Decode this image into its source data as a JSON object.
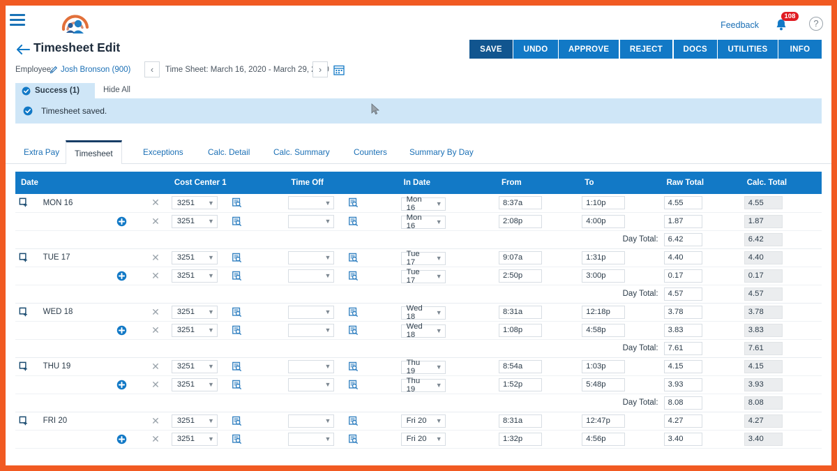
{
  "window": {
    "accent_orange": "#f15a22",
    "brand_blue": "#1279c6"
  },
  "topbar": {
    "menu_icon": "hamburger-icon",
    "logo_icon": "company-logo",
    "feedback_label": "Feedback",
    "bell_icon": "notification-bell-icon",
    "notification_count": "108",
    "help_label": "?"
  },
  "header": {
    "back_icon": "back-arrow-icon",
    "title": "Timesheet Edit",
    "actions": [
      {
        "label": "SAVE",
        "active": true
      },
      {
        "label": "UNDO",
        "active": false
      },
      {
        "label": "APPROVE",
        "active": false
      },
      {
        "label": "REJECT",
        "active": false
      },
      {
        "label": "DOCS",
        "active": false
      },
      {
        "label": "UTILITIES",
        "active": false
      },
      {
        "label": "INFO",
        "active": false
      }
    ]
  },
  "employee_bar": {
    "label": "Employee:",
    "edit_icon": "pencil-icon",
    "name": "Josh Bronson (900)",
    "prev_label": "‹",
    "next_label": "›",
    "timesheet_range": "Time Sheet: March 16, 2020 - March 29, 2020",
    "calendar_icon": "calendar-icon"
  },
  "status": {
    "tab_label": "Success (1)",
    "hide_all_label": "Hide All",
    "message": "Timesheet saved.",
    "check_icon": "check-circle-icon"
  },
  "tabs": [
    {
      "label": "Extra Pay",
      "active": false
    },
    {
      "label": "Timesheet",
      "active": true
    },
    {
      "label": "Exceptions",
      "active": false
    },
    {
      "label": "Calc. Detail",
      "active": false
    },
    {
      "label": "Calc. Summary",
      "active": false
    },
    {
      "label": "Counters",
      "active": false
    },
    {
      "label": "Summary By Day",
      "active": false
    }
  ],
  "table": {
    "columns": [
      "Date",
      "Cost Center 1",
      "Time Off",
      "In Date",
      "From",
      "To",
      "Raw Total",
      "Calc. Total"
    ],
    "day_total_label": "Day Total:",
    "copy_icon": "copy-row-icon",
    "add_icon": "add-row-icon",
    "delete_icon": "delete-row-icon",
    "lookup_icon": "lookup-search-icon",
    "days": [
      {
        "date": "MON 16",
        "day_total_raw": "6.42",
        "day_total_calc": "6.42",
        "entries": [
          {
            "cost_center": "3251",
            "time_off": "",
            "in_date": "Mon 16",
            "from": "8:37a",
            "to": "1:10p",
            "raw_total": "4.55",
            "calc_total": "4.55"
          },
          {
            "cost_center": "3251",
            "time_off": "",
            "in_date": "Mon 16",
            "from": "2:08p",
            "to": "4:00p",
            "raw_total": "1.87",
            "calc_total": "1.87"
          }
        ]
      },
      {
        "date": "TUE 17",
        "day_total_raw": "4.57",
        "day_total_calc": "4.57",
        "entries": [
          {
            "cost_center": "3251",
            "time_off": "",
            "in_date": "Tue 17",
            "from": "9:07a",
            "to": "1:31p",
            "raw_total": "4.40",
            "calc_total": "4.40"
          },
          {
            "cost_center": "3251",
            "time_off": "",
            "in_date": "Tue 17",
            "from": "2:50p",
            "to": "3:00p",
            "raw_total": "0.17",
            "calc_total": "0.17"
          }
        ]
      },
      {
        "date": "WED 18",
        "day_total_raw": "7.61",
        "day_total_calc": "7.61",
        "entries": [
          {
            "cost_center": "3251",
            "time_off": "",
            "in_date": "Wed 18",
            "from": "8:31a",
            "to": "12:18p",
            "raw_total": "3.78",
            "calc_total": "3.78"
          },
          {
            "cost_center": "3251",
            "time_off": "",
            "in_date": "Wed 18",
            "from": "1:08p",
            "to": "4:58p",
            "raw_total": "3.83",
            "calc_total": "3.83"
          }
        ]
      },
      {
        "date": "THU 19",
        "day_total_raw": "8.08",
        "day_total_calc": "8.08",
        "entries": [
          {
            "cost_center": "3251",
            "time_off": "",
            "in_date": "Thu 19",
            "from": "8:54a",
            "to": "1:03p",
            "raw_total": "4.15",
            "calc_total": "4.15"
          },
          {
            "cost_center": "3251",
            "time_off": "",
            "in_date": "Thu 19",
            "from": "1:52p",
            "to": "5:48p",
            "raw_total": "3.93",
            "calc_total": "3.93"
          }
        ]
      },
      {
        "date": "FRI 20",
        "day_total_raw": "",
        "day_total_calc": "",
        "entries": [
          {
            "cost_center": "3251",
            "time_off": "",
            "in_date": "Fri 20",
            "from": "8:31a",
            "to": "12:47p",
            "raw_total": "4.27",
            "calc_total": "4.27"
          },
          {
            "cost_center": "3251",
            "time_off": "",
            "in_date": "Fri 20",
            "from": "1:32p",
            "to": "4:56p",
            "raw_total": "3.40",
            "calc_total": "3.40"
          }
        ]
      }
    ]
  }
}
